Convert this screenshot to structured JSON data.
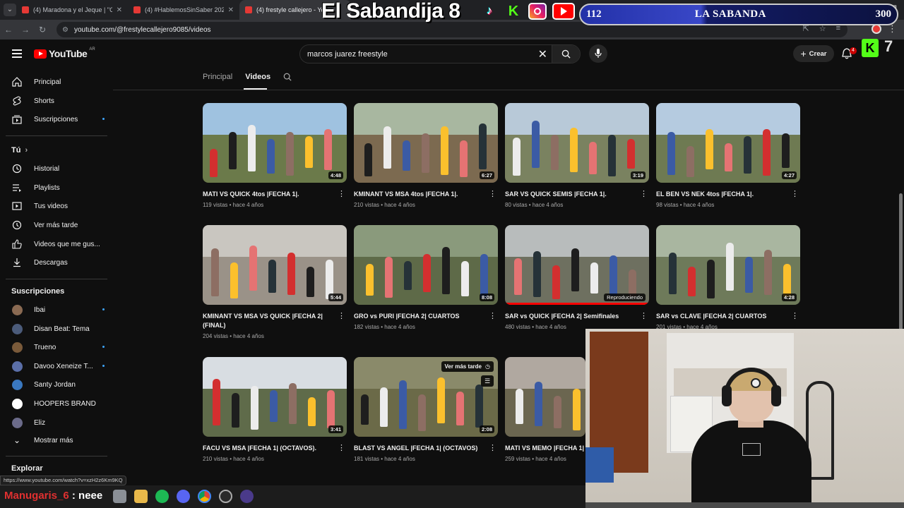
{
  "browser": {
    "tabs": [
      {
        "title": "(4) Maradona y el Jeque | \"Cop"
      },
      {
        "title": "(4) #HablemosSinSaber 2024 | E"
      },
      {
        "title": "(4) frestyle callejero - You"
      }
    ],
    "url": "youtube.com/@frestylecallejero9085/videos",
    "status_url": "https://www.youtube.com/watch?v=xzH2z6Km9KQ"
  },
  "overlay": {
    "title": "El Sabandija 8",
    "counter_left": "112",
    "counter_name": "LA SABANDA",
    "counter_right": "300",
    "kick_count": "7"
  },
  "youtube": {
    "logo_text": "YouTube",
    "country": "AR",
    "search_value": "marcos juarez freestyle",
    "create_label": "Crear",
    "notif_count": "4"
  },
  "sidebar": {
    "main": [
      {
        "label": "Principal",
        "icon": "home-icon"
      },
      {
        "label": "Shorts",
        "icon": "shorts-icon"
      },
      {
        "label": "Suscripciones",
        "icon": "subscriptions-icon"
      }
    ],
    "you_title": "Tú",
    "you": [
      {
        "label": "Historial",
        "icon": "history-icon"
      },
      {
        "label": "Playlists",
        "icon": "playlists-icon"
      },
      {
        "label": "Tus videos",
        "icon": "your-videos-icon"
      },
      {
        "label": "Ver más tarde",
        "icon": "watch-later-icon"
      },
      {
        "label": "Videos que me gus...",
        "icon": "like-icon"
      },
      {
        "label": "Descargas",
        "icon": "download-icon"
      }
    ],
    "subs_title": "Suscripciones",
    "subs": [
      {
        "label": "Ibai",
        "color": "#8a6a52"
      },
      {
        "label": "Disan Beat: Tema",
        "color": "#4b5b7a"
      },
      {
        "label": "Trueno",
        "color": "#7a5a3a"
      },
      {
        "label": "Davoo Xeneize T...",
        "color": "#5b6fa8"
      },
      {
        "label": "Santy Jordan",
        "color": "#3a78c0"
      },
      {
        "label": "HOOPERS BRAND",
        "color": "#ffffff"
      },
      {
        "label": "Eliz",
        "color": "#6b6b8a"
      }
    ],
    "show_more": "Mostrar más",
    "explore": "Explorar"
  },
  "channel_tabs": {
    "home": "Principal",
    "videos": "Videos"
  },
  "videos": [
    {
      "title": "MATI VS QUICK 4tos |FECHA 1|.",
      "meta": "119 vistas • hace 4 años",
      "duration": "4:48",
      "sky": "#9fc2e0",
      "ground": "#6b7a4a"
    },
    {
      "title": "KMINANT VS MSA 4tos |FECHA 1|.",
      "meta": "210 vistas • hace 4 años",
      "duration": "6:27",
      "sky": "#a8b7a0",
      "ground": "#7c6a50"
    },
    {
      "title": "SAR VS QUICK SEMIS |FECHA 1|.",
      "meta": "80 vistas • hace 4 años",
      "duration": "3:19",
      "sky": "#b8c9d8",
      "ground": "#7a8260"
    },
    {
      "title": "EL BEN VS NEK 4tos |FECHA 1|.",
      "meta": "98 vistas • hace 4 años",
      "duration": "4:27",
      "sky": "#b5cbe0",
      "ground": "#6e7a52"
    },
    {
      "title": "KMINANT VS MSA VS QUICK |FECHA 2| (FINAL)",
      "meta": "204 vistas • hace 4 años",
      "duration": "5:44",
      "sky": "#c9c6c0",
      "ground": "#9a9288"
    },
    {
      "title": "GRO vs PURI |FECHA 2| CUARTOS",
      "meta": "182 vistas • hace 4 años",
      "duration": "8:08",
      "sky": "#8a9a7c",
      "ground": "#5e6a48"
    },
    {
      "title": "SAR vs QUICK |FECHA 2| Semifinales",
      "meta": "480 vistas • hace 4 años",
      "duration": "",
      "badge": "Reproduciendo",
      "sky": "#b8bcbc",
      "ground": "#6e7060"
    },
    {
      "title": "SAR vs CLAVE |FECHA 2| CUARTOS",
      "meta": "201 vistas • hace 4 años",
      "duration": "4:28",
      "sky": "#a9b6a0",
      "ground": "#6e7a5a"
    },
    {
      "title": "FACU VS MSA |FECHA 1| (OCTAVOS).",
      "meta": "210 vistas • hace 4 años",
      "duration": "3:41",
      "sky": "#d8dde2",
      "ground": "#5f6b4a"
    },
    {
      "title": "BLAST VS ANGEL |FECHA 1| (OCTAVOS)",
      "meta": "181 vistas • hace 4 años",
      "duration": "2:08",
      "hover_label": "Ver más tarde",
      "sky": "#8a8a6a",
      "ground": "#6b6a48"
    },
    {
      "title": "MATI VS MEMO |FECHA 1| (",
      "meta": "259 vistas • hace 4 años",
      "duration": "",
      "sky": "#b0a8a0",
      "ground": "#6b6650"
    }
  ],
  "chat": {
    "user": "Manugaris_6",
    "message": " : neee"
  }
}
